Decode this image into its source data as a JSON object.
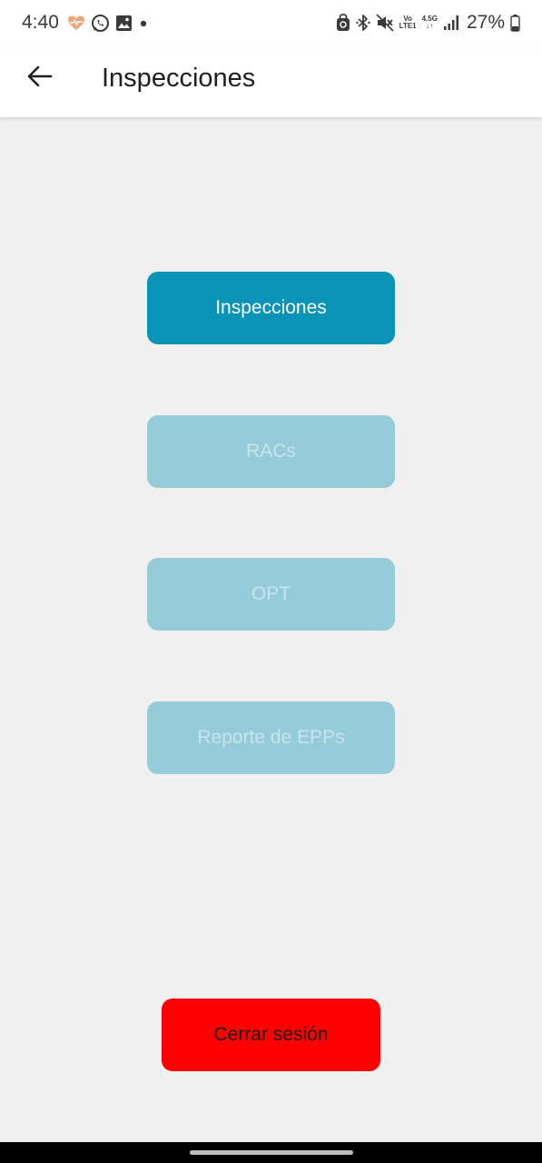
{
  "status_bar": {
    "time": "4:40",
    "left_icons": [
      "heart-pulse-icon",
      "whatsapp-icon",
      "gallery-icon",
      "dot-icon"
    ],
    "right_icons": [
      "vpn-lock-icon",
      "bluetooth-icon",
      "mute-icon",
      "volte-icon",
      "4-5g-icon",
      "signal-icon",
      "battery-icon"
    ],
    "volte_top": "Vo",
    "volte_bottom": "LTE1",
    "network": "4.5G",
    "battery": "27%"
  },
  "app_bar": {
    "title": "Inspecciones",
    "back_icon": "arrow-back-icon"
  },
  "menu": {
    "inspecciones": "Inspecciones",
    "racs": "RACs",
    "opt": "OPT",
    "reporte_epps": "Reporte de EPPs"
  },
  "logout": {
    "label": "Cerrar sesión"
  },
  "colors": {
    "primary": "#0993b6",
    "disabled": "#96ccda",
    "logout": "#ff0000",
    "background": "#f0f0f0"
  }
}
